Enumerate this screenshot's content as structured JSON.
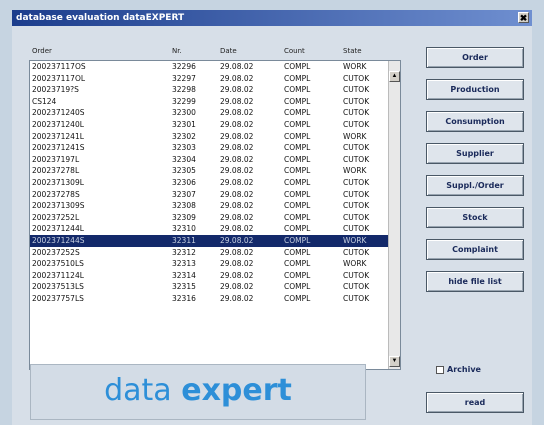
{
  "window": {
    "title": "database evaluation dataEXPERT",
    "close_glyph": "✖"
  },
  "list": {
    "headers": {
      "order": "Order",
      "nr": "Nr.",
      "date": "Date",
      "count": "Count",
      "state": "State"
    },
    "rows": [
      {
        "order": "200237117OS",
        "nr": "32296",
        "date": "29.08.02",
        "count": "COMPL",
        "state": "WORK"
      },
      {
        "order": "200237117OL",
        "nr": "32297",
        "date": "29.08.02",
        "count": "COMPL",
        "state": "CUTOK"
      },
      {
        "order": "20023719?S",
        "nr": "32298",
        "date": "29.08.02",
        "count": "COMPL",
        "state": "CUTOK"
      },
      {
        "order": "CS124",
        "nr": "32299",
        "date": "29.08.02",
        "count": "COMPL",
        "state": "CUTOK"
      },
      {
        "order": "2002371240S",
        "nr": "32300",
        "date": "29.08.02",
        "count": "COMPL",
        "state": "CUTOK"
      },
      {
        "order": "2002371240L",
        "nr": "32301",
        "date": "29.08.02",
        "count": "COMPL",
        "state": "CUTOK"
      },
      {
        "order": "2002371241L",
        "nr": "32302",
        "date": "29.08.02",
        "count": "COMPL",
        "state": "WORK"
      },
      {
        "order": "2002371241S",
        "nr": "32303",
        "date": "29.08.02",
        "count": "COMPL",
        "state": "CUTOK"
      },
      {
        "order": "200237197L",
        "nr": "32304",
        "date": "29.08.02",
        "count": "COMPL",
        "state": "CUTOK"
      },
      {
        "order": "200237278L",
        "nr": "32305",
        "date": "29.08.02",
        "count": "COMPL",
        "state": "WORK"
      },
      {
        "order": "2002371309L",
        "nr": "32306",
        "date": "29.08.02",
        "count": "COMPL",
        "state": "CUTOK"
      },
      {
        "order": "200237278S",
        "nr": "32307",
        "date": "29.08.02",
        "count": "COMPL",
        "state": "CUTOK"
      },
      {
        "order": "2002371309S",
        "nr": "32308",
        "date": "29.08.02",
        "count": "COMPL",
        "state": "CUTOK"
      },
      {
        "order": "200237252L",
        "nr": "32309",
        "date": "29.08.02",
        "count": "COMPL",
        "state": "CUTOK"
      },
      {
        "order": "2002371244L",
        "nr": "32310",
        "date": "29.08.02",
        "count": "COMPL",
        "state": "CUTOK"
      },
      {
        "order": "2002371244S",
        "nr": "32311",
        "date": "29.08.02",
        "count": "COMPL",
        "state": "WORK",
        "selected": true
      },
      {
        "order": "200237252S",
        "nr": "32312",
        "date": "29.08.02",
        "count": "COMPL",
        "state": "CUTOK"
      },
      {
        "order": "200237510LS",
        "nr": "32313",
        "date": "29.08.02",
        "count": "COMPL",
        "state": "WORK"
      },
      {
        "order": "2002371124L",
        "nr": "32314",
        "date": "29.08.02",
        "count": "COMPL",
        "state": "CUTOK"
      },
      {
        "order": "200237513LS",
        "nr": "32315",
        "date": "29.08.02",
        "count": "COMPL",
        "state": "CUTOK"
      },
      {
        "order": "200237757LS",
        "nr": "32316",
        "date": "29.08.02",
        "count": "COMPL",
        "state": "CUTOK"
      }
    ]
  },
  "buttons": {
    "order": "Order",
    "production": "Production",
    "consumption": "Consumption",
    "supplier": "Supplier",
    "suppl_order": "Suppl./Order",
    "stock": "Stock",
    "complaint": "Complaint",
    "hide_file_list": "hide file list",
    "read": "read"
  },
  "archive": {
    "label": "Archive",
    "checked": false
  },
  "logo": {
    "part1": "data",
    "part2": "expert"
  },
  "colors": {
    "selection": "#13296a",
    "logo": "#2d8fd8",
    "title_bar": "#1c3d8c"
  }
}
